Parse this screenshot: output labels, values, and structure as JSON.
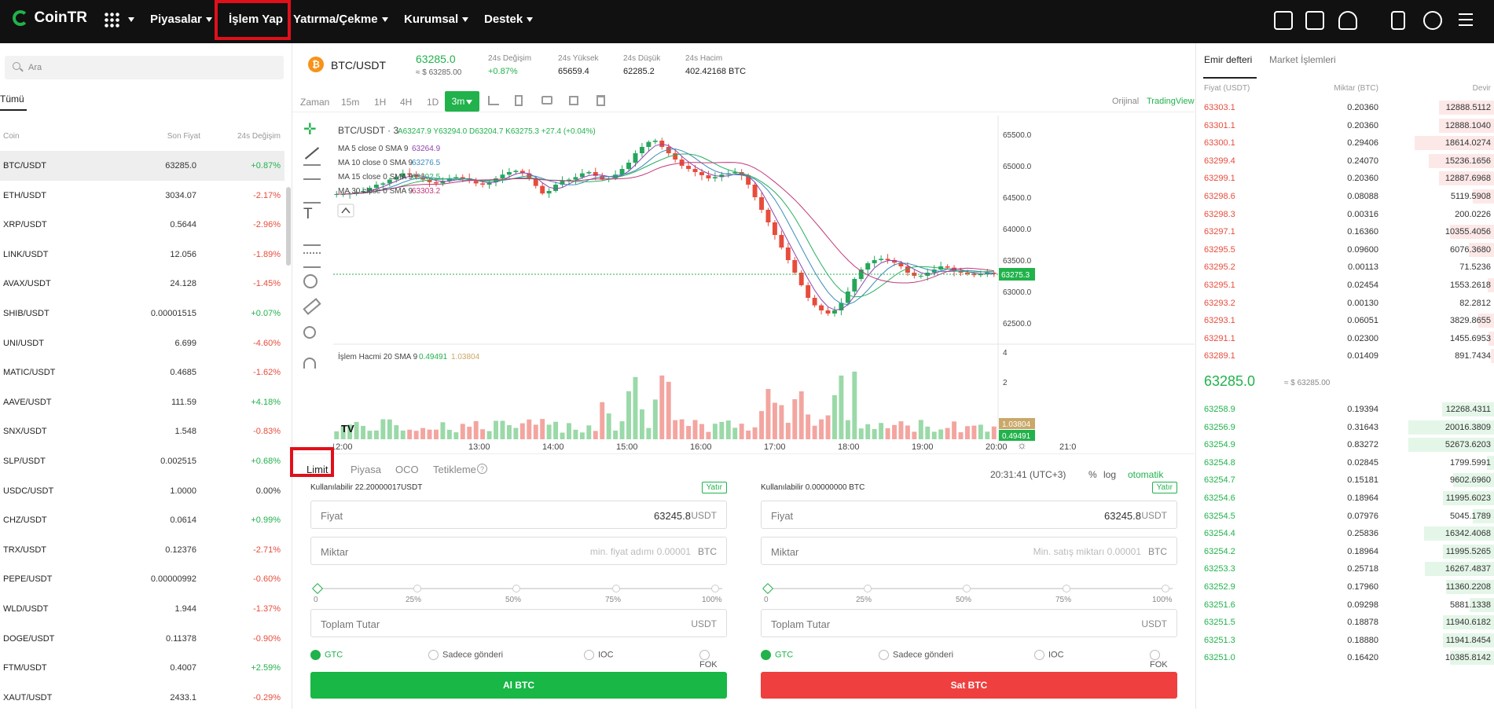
{
  "nav": {
    "logo": "CoinTR",
    "items": [
      "Piyasalar",
      "İşlem Yap",
      "Yatırma/Çekme",
      "Kurumsal",
      "Destek"
    ]
  },
  "search": {
    "placeholder": "Ara"
  },
  "market_tab": "Tümü",
  "market_headers": [
    "Coin",
    "Son Fiyat",
    "24s Değişim"
  ],
  "markets": [
    {
      "pair": "BTC/USDT",
      "price": "63285.0",
      "change": "+0.87%",
      "dir": "up"
    },
    {
      "pair": "ETH/USDT",
      "price": "3034.07",
      "change": "-2.17%",
      "dir": "dn"
    },
    {
      "pair": "XRP/USDT",
      "price": "0.5644",
      "change": "-2.96%",
      "dir": "dn"
    },
    {
      "pair": "LINK/USDT",
      "price": "12.056",
      "change": "-1.89%",
      "dir": "dn"
    },
    {
      "pair": "AVAX/USDT",
      "price": "24.128",
      "change": "-1.45%",
      "dir": "dn"
    },
    {
      "pair": "SHIB/USDT",
      "price": "0.00001515",
      "change": "+0.07%",
      "dir": "up"
    },
    {
      "pair": "UNI/USDT",
      "price": "6.699",
      "change": "-4.60%",
      "dir": "dn"
    },
    {
      "pair": "MATIC/USDT",
      "price": "0.4685",
      "change": "-1.62%",
      "dir": "dn"
    },
    {
      "pair": "AAVE/USDT",
      "price": "111.59",
      "change": "+4.18%",
      "dir": "up"
    },
    {
      "pair": "SNX/USDT",
      "price": "1.548",
      "change": "-0.83%",
      "dir": "dn"
    },
    {
      "pair": "SLP/USDT",
      "price": "0.002515",
      "change": "+0.68%",
      "dir": "up"
    },
    {
      "pair": "USDC/USDT",
      "price": "1.0000",
      "change": "0.00%",
      "dir": "zero"
    },
    {
      "pair": "CHZ/USDT",
      "price": "0.0614",
      "change": "+0.99%",
      "dir": "up"
    },
    {
      "pair": "TRX/USDT",
      "price": "0.12376",
      "change": "-2.71%",
      "dir": "dn"
    },
    {
      "pair": "PEPE/USDT",
      "price": "0.00000992",
      "change": "-0.60%",
      "dir": "dn"
    },
    {
      "pair": "WLD/USDT",
      "price": "1.944",
      "change": "-1.37%",
      "dir": "dn"
    },
    {
      "pair": "DOGE/USDT",
      "price": "0.11378",
      "change": "-0.90%",
      "dir": "dn"
    },
    {
      "pair": "FTM/USDT",
      "price": "0.4007",
      "change": "+2.59%",
      "dir": "up"
    },
    {
      "pair": "XAUT/USDT",
      "price": "2433.1",
      "change": "-0.29%",
      "dir": "dn"
    }
  ],
  "ticker": {
    "pair": "BTC/USDT",
    "price": "63285.0",
    "usd": "≈ $ 63285.00",
    "stats": [
      {
        "label": "24s Değişim",
        "value": "+0.87%"
      },
      {
        "label": "24s Yüksek",
        "value": "65659.4"
      },
      {
        "label": "24s Düşük",
        "value": "62285.2"
      },
      {
        "label": "24s Hacim",
        "value": "402.42168 BTC"
      }
    ]
  },
  "timeframes": [
    "Zaman",
    "15m",
    "1H",
    "4H",
    "1D",
    "3m"
  ],
  "view_modes": [
    "Orijinal",
    "TradingView"
  ],
  "chart": {
    "header": "BTC/USDT · 3",
    "ohlc": "A63247.9 Y63294.0 D63204.7 K63275.3 +27.4 (+0.04%)",
    "ma": [
      {
        "label": "MA 5 close 0 SMA 9",
        "value": "63264.9",
        "color": "#8e44ad"
      },
      {
        "label": "MA 10 close 0 SMA 9",
        "value": "63276.5",
        "color": "#3c8dbc"
      },
      {
        "label": "MA 15 close 0 SMA 9",
        "value": "63292.5",
        "color": "#27ae60"
      },
      {
        "label": "MA 30 close 0 SMA 9",
        "value": "63303.2",
        "color": "#c0397a"
      }
    ],
    "volume_label": "İşlem Hacmi 20 SMA 9",
    "volume_values": [
      "0.49491",
      "1.03804"
    ],
    "price_ticks": [
      "65500.0",
      "65000.0",
      "64500.0",
      "64000.0",
      "63500.0",
      "63000.0",
      "62500.0"
    ],
    "last_price": "63275.3",
    "volume_ticks": [
      "4",
      "2"
    ],
    "time_ticks": [
      "12:00",
      "13:00",
      "14:00",
      "15:00",
      "16:00",
      "17:00",
      "18:00",
      "19:00",
      "20:00",
      "21:0"
    ],
    "clock": "20:31:41 (UTC+3)",
    "scale_opts": [
      "%",
      "log",
      "otomatik"
    ]
  },
  "order_tabs": [
    "Limit",
    "Piyasa",
    "OCO",
    "Tetikleme"
  ],
  "buy": {
    "available": "Kullanılabilir 22.20000017USDT",
    "deposit": "Yatır",
    "price_label": "Fiyat",
    "price": "63245.8",
    "price_unit": "USDT",
    "amount_label": "Miktar",
    "amount_ph": "min. fiyat adımı 0.00001",
    "amount_unit": "BTC",
    "total_label": "Toplam Tutar",
    "total_unit": "USDT",
    "button": "Al BTC"
  },
  "sell": {
    "available": "Kullanılabilir 0.00000000 BTC",
    "deposit": "Yatır",
    "price_label": "Fiyat",
    "price": "63245.8",
    "price_unit": "USDT",
    "amount_label": "Miktar",
    "amount_ph": "Min. satış miktarı 0.00001",
    "amount_unit": "BTC",
    "total_label": "Toplam Tutar",
    "total_unit": "USDT",
    "button": "Sat BTC"
  },
  "pcts": [
    "0",
    "25%",
    "50%",
    "75%",
    "100%"
  ],
  "tif": [
    "GTC",
    "Sadece gönderi",
    "IOC",
    "FOK"
  ],
  "book_tabs": [
    "Emir defteri",
    "Market İşlemleri"
  ],
  "book_headers": [
    "Fiyat (USDT)",
    "Miktar (BTC)",
    "Devir"
  ],
  "asks": [
    [
      "63303.1",
      "0.20360",
      "12888.5112"
    ],
    [
      "63301.1",
      "0.20360",
      "12888.1040"
    ],
    [
      "63300.1",
      "0.29406",
      "18614.0274"
    ],
    [
      "63299.4",
      "0.24070",
      "15236.1656"
    ],
    [
      "63299.1",
      "0.20360",
      "12887.6968"
    ],
    [
      "63298.6",
      "0.08088",
      "5119.5908"
    ],
    [
      "63298.3",
      "0.00316",
      "200.0226"
    ],
    [
      "63297.1",
      "0.16360",
      "10355.4056"
    ],
    [
      "63295.5",
      "0.09600",
      "6076.3680"
    ],
    [
      "63295.2",
      "0.00113",
      "71.5236"
    ],
    [
      "63295.1",
      "0.02454",
      "1553.2618"
    ],
    [
      "63293.2",
      "0.00130",
      "82.2812"
    ],
    [
      "63293.1",
      "0.06051",
      "3829.8655"
    ],
    [
      "63291.1",
      "0.02300",
      "1455.6953"
    ],
    [
      "63289.1",
      "0.01409",
      "891.7434"
    ]
  ],
  "mid": {
    "price": "63285.0",
    "usd": "≈ $ 63285.00"
  },
  "bids": [
    [
      "63258.9",
      "0.19394",
      "12268.4311"
    ],
    [
      "63256.9",
      "0.31643",
      "20016.3809"
    ],
    [
      "63254.9",
      "0.83272",
      "52673.6203"
    ],
    [
      "63254.8",
      "0.02845",
      "1799.5991"
    ],
    [
      "63254.7",
      "0.15181",
      "9602.6960"
    ],
    [
      "63254.6",
      "0.18964",
      "11995.6023"
    ],
    [
      "63254.5",
      "0.07976",
      "5045.1789"
    ],
    [
      "63254.4",
      "0.25836",
      "16342.4068"
    ],
    [
      "63254.2",
      "0.18964",
      "11995.5265"
    ],
    [
      "63253.3",
      "0.25718",
      "16267.4837"
    ],
    [
      "63252.9",
      "0.17960",
      "11360.2208"
    ],
    [
      "63251.6",
      "0.09298",
      "5881.1338"
    ],
    [
      "63251.5",
      "0.18878",
      "11940.6182"
    ],
    [
      "63251.3",
      "0.18880",
      "11941.8454"
    ],
    [
      "63251.0",
      "0.16420",
      "10385.8142"
    ]
  ]
}
